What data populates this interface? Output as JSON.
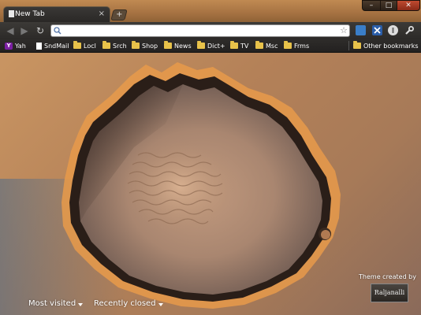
{
  "tab": {
    "title": "New Tab",
    "close_glyph": "×"
  },
  "tabstrip": {
    "new_tab_glyph": "+"
  },
  "window_controls": {
    "minimize": "–",
    "maximize": "□",
    "close": "✕"
  },
  "toolbar": {
    "back_glyph": "◀",
    "forward_glyph": "▶",
    "reload_glyph": "↻",
    "omnibox": {
      "value": "",
      "placeholder": ""
    },
    "star_glyph": "☆",
    "extensions": [
      "screen-capture-icon",
      "x-extension-icon",
      "circle-extension-icon",
      "wrench-icon"
    ]
  },
  "bookmarks": {
    "items": [
      {
        "label": "Yah",
        "icon": "yahoo-icon"
      },
      {
        "label": "SndMail",
        "icon": "page-icon"
      },
      {
        "label": "Locl",
        "icon": "folder-icon"
      },
      {
        "label": "Srch",
        "icon": "folder-icon"
      },
      {
        "label": "Shop",
        "icon": "folder-icon"
      },
      {
        "label": "News",
        "icon": "folder-icon"
      },
      {
        "label": "Dict+",
        "icon": "folder-icon"
      },
      {
        "label": "TV",
        "icon": "folder-icon"
      },
      {
        "label": "Msc",
        "icon": "folder-icon"
      },
      {
        "label": "Frms",
        "icon": "folder-icon"
      }
    ],
    "other": "Other bookmarks"
  },
  "ntp": {
    "most_visited": "Most visited",
    "recently_closed": "Recently closed",
    "theme_credit": "Theme created by",
    "theme_logo": "Raljanalli"
  },
  "colors": {
    "tabstrip": "#a87443",
    "toolbar": "#33312e",
    "folder": "#e8c24a",
    "close_button": "#c04a30"
  }
}
